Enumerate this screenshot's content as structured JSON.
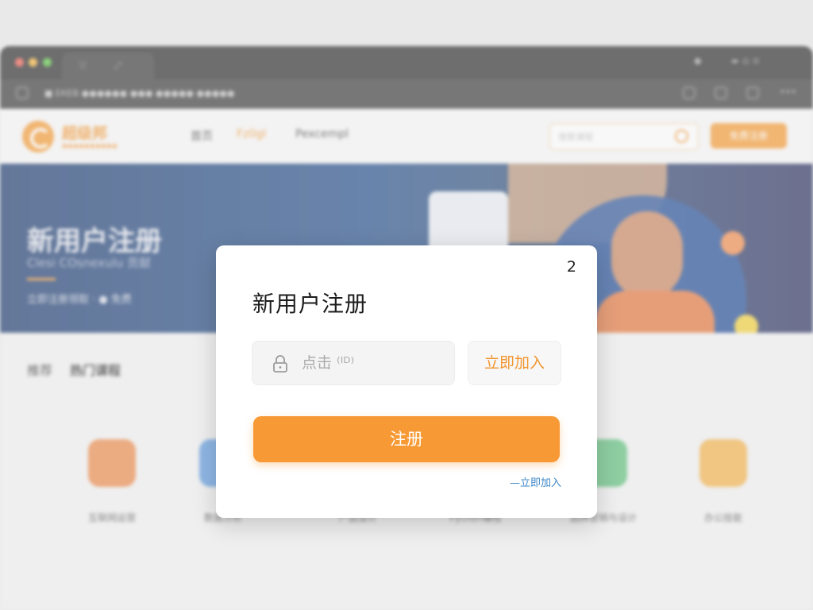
{
  "background": {
    "window": {
      "tab_icons": [
        "▽",
        "⤢"
      ],
      "address_text": "■ ЕКЕВ ●●●●●●   ●●●   ●●●●● ●●●●●",
      "right_icons": [
        "●",
        "◂▸ ◎ ⊘"
      ]
    },
    "header": {
      "logo_text": "超级邦",
      "logo_sub": "●●●●●●●●●●",
      "nav": [
        "首页",
        "Fz0gl",
        "Pexcempl"
      ],
      "search_placeholder": "搜索课程",
      "button_label": "免费注册"
    },
    "banner": {
      "title": "新用户注册",
      "subtitle": "Clesi   COsnexulu   贡献   ",
      "cta": "立即注册领取 · ● 免费"
    },
    "section": {
      "tab_a": "推荐",
      "tab_b": "热门课程"
    },
    "cards": [
      "互联网运营",
      "数据分析",
      "产品设计",
      "Python编程",
      "品牌营销与设计",
      "办公技能"
    ]
  },
  "modal": {
    "close_label": "2",
    "title": "新用户注册",
    "input": {
      "value": "",
      "placeholder": "点击 ⁽ᴵᴰ⁾"
    },
    "join_button": "立即加入",
    "register_button": "注册",
    "join_link": "—立即加入"
  },
  "colors": {
    "accent": "#f79a35",
    "link": "#3f87c8"
  },
  "icons": {
    "input_icon": "lock-icon",
    "search_icon": "search-icon"
  }
}
